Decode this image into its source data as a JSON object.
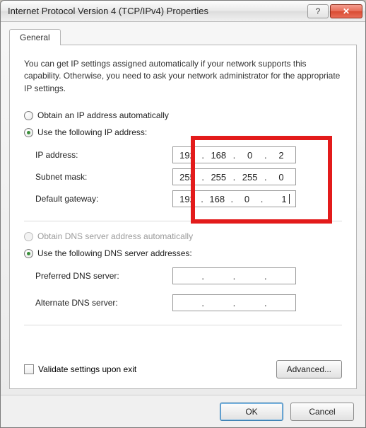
{
  "window": {
    "title": "Internet Protocol Version 4 (TCP/IPv4) Properties"
  },
  "tabs": {
    "general": "General"
  },
  "intro": "You can get IP settings assigned automatically if your network supports this capability. Otherwise, you need to ask your network administrator for the appropriate IP settings.",
  "ip": {
    "auto_label": "Obtain an IP address automatically",
    "manual_label": "Use the following IP address:",
    "auto_selected": false,
    "addr_label": "IP address:",
    "mask_label": "Subnet mask:",
    "gw_label": "Default gateway:",
    "addr": {
      "o1": "192",
      "o2": "168",
      "o3": "0",
      "o4": "2"
    },
    "mask": {
      "o1": "255",
      "o2": "255",
      "o3": "255",
      "o4": "0"
    },
    "gw": {
      "o1": "192",
      "o2": "168",
      "o3": "0",
      "o4": "1"
    }
  },
  "dns": {
    "auto_label": "Obtain DNS server address automatically",
    "manual_label": "Use the following DNS server addresses:",
    "pref_label": "Preferred DNS server:",
    "alt_label": "Alternate DNS server:",
    "pref": {
      "o1": "",
      "o2": "",
      "o3": "",
      "o4": ""
    },
    "alt": {
      "o1": "",
      "o2": "",
      "o3": "",
      "o4": ""
    }
  },
  "validate_label": "Validate settings upon exit",
  "buttons": {
    "advanced": "Advanced...",
    "ok": "OK",
    "cancel": "Cancel"
  }
}
